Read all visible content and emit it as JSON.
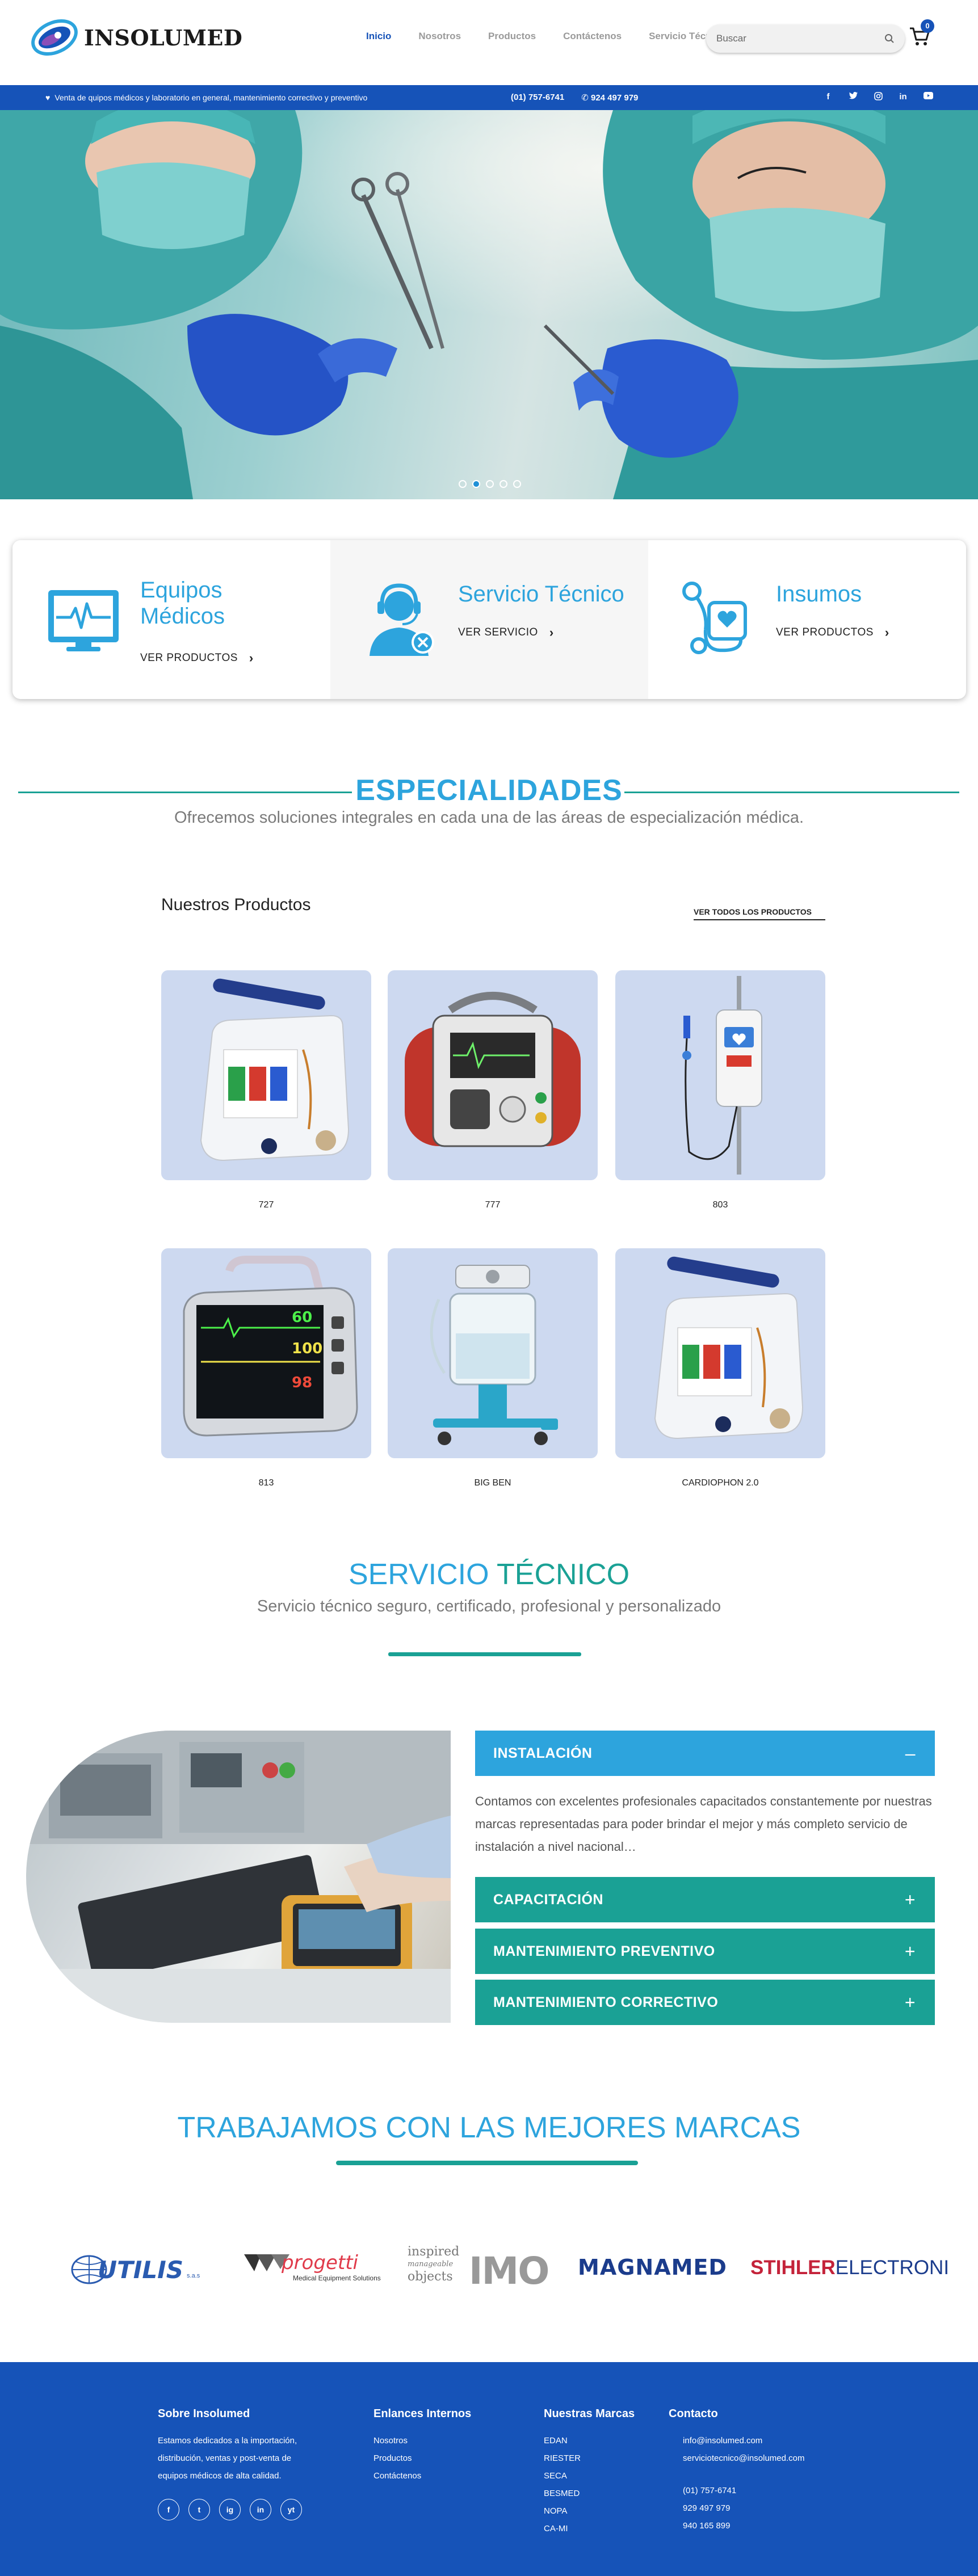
{
  "header": {
    "logo_text": "INSOLUMED",
    "nav": [
      "Inicio",
      "Nosotros",
      "Productos",
      "Contáctenos",
      "Servicio Técnico"
    ],
    "search_placeholder": "Buscar",
    "cart_count": "0"
  },
  "topbar": {
    "tagline": "Venta de quipos médicos y laboratorio en general, mantenimiento correctivo y preventivo",
    "phone1": "(01) 757-6741",
    "phone2": "924 497 979",
    "social_icons": [
      "facebook-icon",
      "twitter-icon",
      "instagram-icon",
      "linkedin-icon",
      "youtube-icon"
    ]
  },
  "hero": {
    "slide_count": 5,
    "active_slide": 2
  },
  "features": [
    {
      "title_line1": "Equipos",
      "title_line2": "Médicos",
      "link": "VER PRODUCTOS",
      "icon": "monitor-heartbeat-icon"
    },
    {
      "title_line1": "Servicio Técnico",
      "title_line2": "",
      "link": "VER SERVICIO",
      "icon": "technician-icon"
    },
    {
      "title_line1": "Insumos",
      "title_line2": "",
      "link": "VER PRODUCTOS",
      "icon": "stethoscope-icon"
    }
  ],
  "specialties": {
    "title": "ESPECIALIDADES",
    "subtitle": "Ofrecemos soluciones integrales en cada una de las áreas de especialización médica."
  },
  "products": {
    "title": "Nuestros Productos",
    "view_all": "VER TODOS LOS PRODUCTOS",
    "items": [
      {
        "name": "727"
      },
      {
        "name": "777"
      },
      {
        "name": "803"
      },
      {
        "name": "813"
      },
      {
        "name": "BIG BEN"
      },
      {
        "name": "CARDIOPHON 2.0"
      }
    ]
  },
  "service": {
    "title_part1": "SERVICIO ",
    "title_part2": "TÉCNICO",
    "subtitle": "Servicio técnico seguro, certificado, profesional y personalizado",
    "accordion": [
      {
        "label": "INSTALACIÓN",
        "sign": "–",
        "open": true
      },
      {
        "label": "CAPACITACIÓN",
        "sign": "+"
      },
      {
        "label": "MANTENIMIENTO PREVENTIVO",
        "sign": "+"
      },
      {
        "label": "MANTENIMIENTO CORRECTIVO",
        "sign": "+"
      }
    ],
    "open_text": "Contamos con excelentes profesionales capacitados constantemente por nuestras marcas representadas para poder brindar el mejor y más completo servicio de instalación a nivel nacional…"
  },
  "brands": {
    "title": "TRABAJAMOS CON LAS MEJORES MARCAS",
    "names": [
      "UTILIS",
      "s.a.s",
      "progetti",
      "Medical Equipment Solutions",
      "inspired",
      "manageable",
      "objects",
      "IMO",
      "MAGNAMED",
      "STIHLER",
      "ELECTRONI"
    ]
  },
  "footer": {
    "about_title": "Sobre Insolumed",
    "about_text": [
      "Estamos dedicados a la importación,",
      "distribución, ventas y post-venta de",
      "equipos médicos de alta calidad."
    ],
    "links_title": "Enlances Internos",
    "links": [
      "Nosotros",
      "Productos",
      "Contáctenos"
    ],
    "brands_title": "Nuestras Marcas",
    "brands": [
      "EDAN",
      "RIESTER",
      "SECA",
      "BESMED",
      "NOPA",
      "CA-MI"
    ],
    "contact_title": "Contacto",
    "emails": [
      "info@insolumed.com",
      "serviciotecnico@insolumed.com"
    ],
    "phones": [
      "(01) 757-6741",
      "929 497 979",
      "940 165 899"
    ],
    "social_letters": [
      "f",
      "t",
      "ig",
      "in",
      "yt"
    ]
  },
  "colors": {
    "brand_blue": "#1653b8",
    "accent_blue": "#2da4dd",
    "teal": "#1aa195",
    "product_bg": "#cdd9f0"
  }
}
